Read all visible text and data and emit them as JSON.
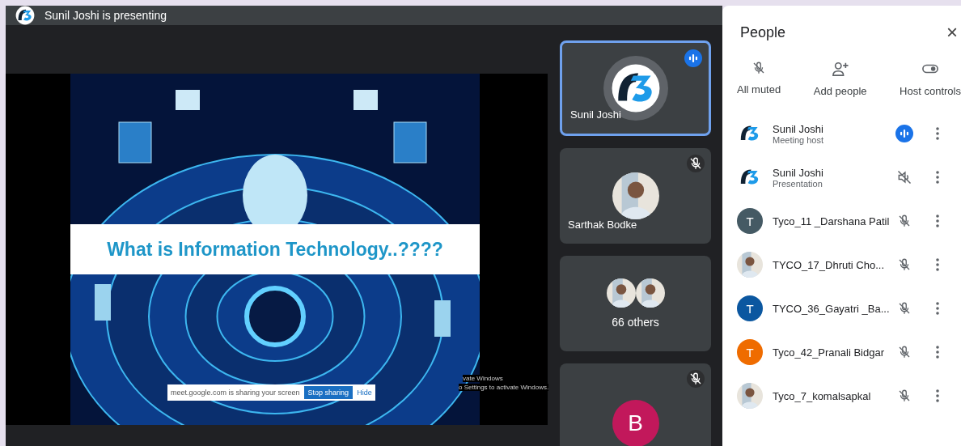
{
  "presenting_bar": {
    "title": "Sunil Joshi is presenting"
  },
  "slide": {
    "kind": "picture",
    "title": "What is Information Technology..????",
    "share_notice": {
      "text": "meet.google.com is sharing your screen",
      "stop_button": "Stop sharing",
      "hide_button": "Hide"
    },
    "watermark_lines": [
      "vate Windows",
      "o Settings to activate Windows."
    ]
  },
  "tiles": [
    {
      "kind": "logo",
      "name": "Sunil Joshi",
      "selected": true,
      "mic": {
        "kind": "speaking"
      }
    },
    {
      "name": "Sarthak Bodke",
      "selected": false,
      "mic": {
        "kind": "muted"
      }
    },
    {
      "kind": "group",
      "name": "66 others",
      "selected": false
    },
    {
      "kind": "initial",
      "initial": "B",
      "color": "#c2185b",
      "selected": false,
      "mic": {
        "kind": "muted"
      }
    }
  ],
  "people_panel": {
    "title": "People",
    "close": "×",
    "actions": [
      {
        "kind": "muted",
        "label": "All muted"
      },
      {
        "kind": "add",
        "label": "Add people"
      },
      {
        "kind": "toggle",
        "label": "Host controls"
      }
    ],
    "participants": [
      {
        "avatar": {
          "kind": "logo"
        },
        "name": "Sunil Joshi",
        "role": "Meeting host",
        "mic": {
          "kind": "speaking"
        }
      },
      {
        "avatar": {
          "kind": "logo"
        },
        "name": "Sunil Joshi",
        "role": "Presentation",
        "mic": {
          "kind": "audio-off"
        }
      },
      {
        "avatar": {
          "kind": "initial",
          "initial": "T",
          "color": "#455a64"
        },
        "name": "Tyco_11 _Darshana Patil",
        "mic": {
          "kind": "muted"
        }
      },
      {
        "name": "TYCO_17_Dhruti Cho...",
        "mic": {
          "kind": "muted"
        }
      },
      {
        "avatar": {
          "kind": "initial",
          "initial": "T",
          "color": "#0b57a0"
        },
        "name": "TYCO_36_Gayatri _Ba...",
        "mic": {
          "kind": "muted"
        }
      },
      {
        "avatar": {
          "kind": "initial",
          "initial": "T",
          "color": "#ef6c00"
        },
        "name": "Tyco_42_Pranali Bidgar",
        "mic": {
          "kind": "muted"
        }
      },
      {
        "name": "Tyco_7_komalsapkal",
        "mic": {
          "kind": "muted"
        }
      }
    ]
  }
}
